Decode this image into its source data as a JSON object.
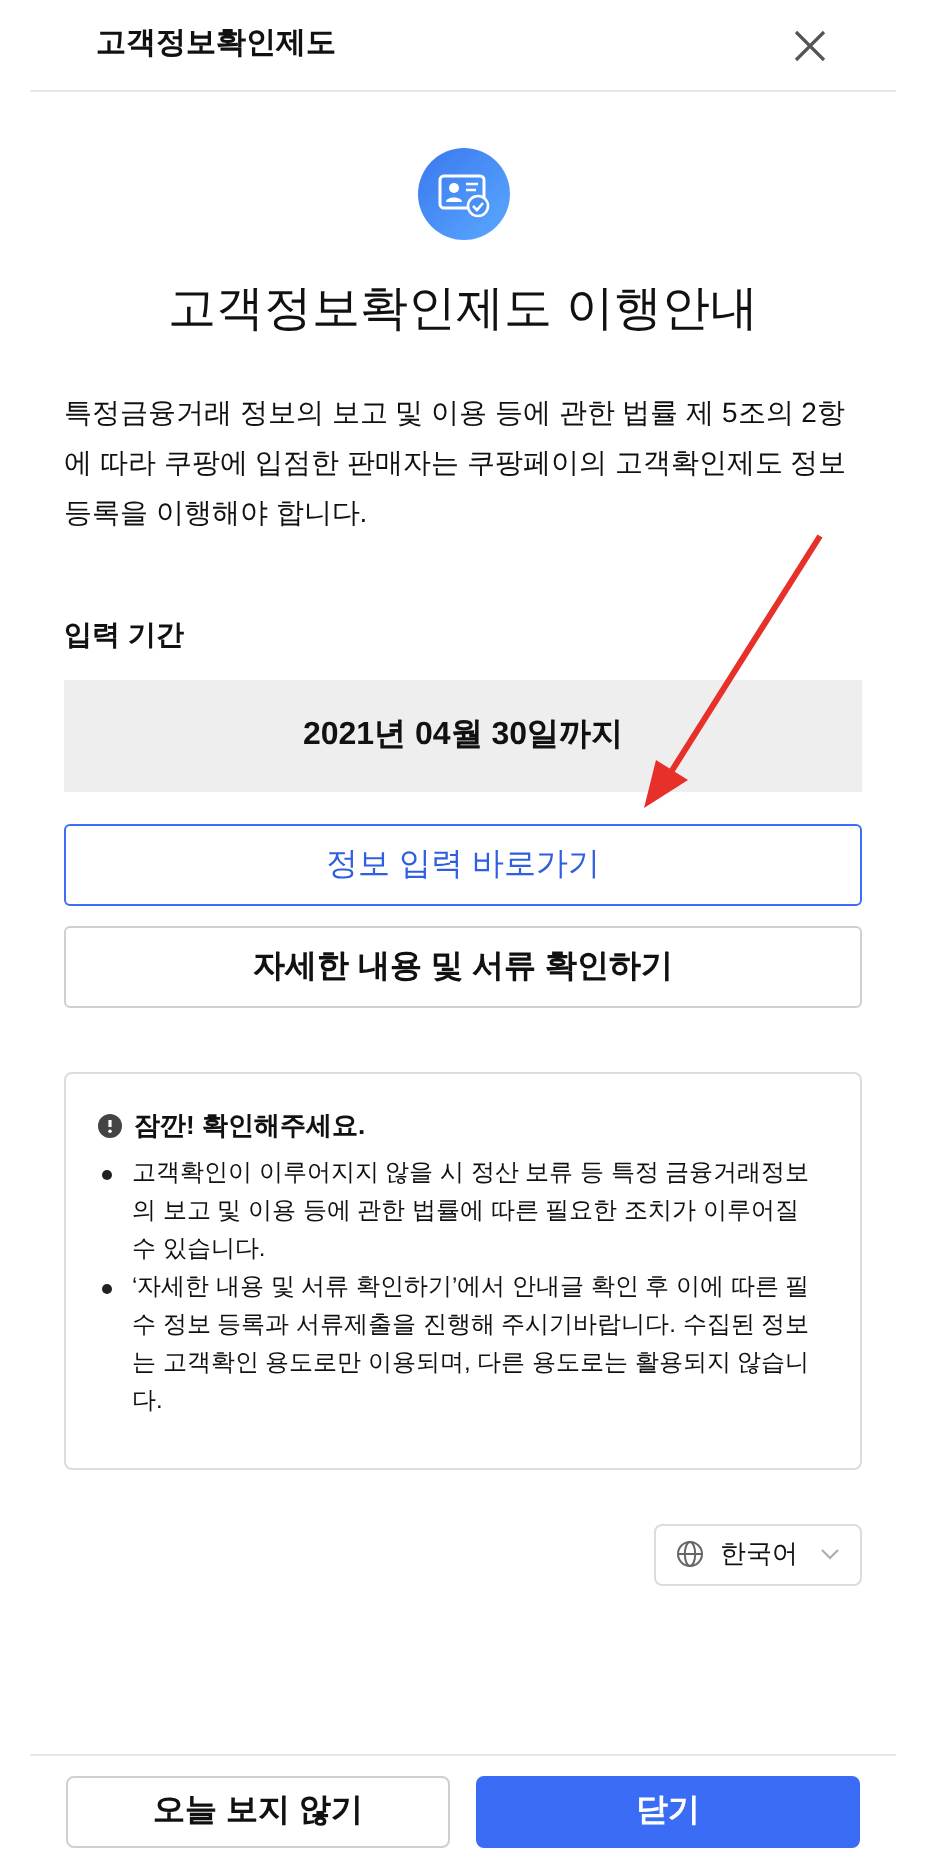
{
  "window": {
    "title": "고객정보확인제도"
  },
  "heading": "고객정보확인제도 이행안내",
  "description": "특정금융거래 정보의 보고 및 이용 등에 관한 법률 제 5조의 2항에 따라 쿠팡에 입점한 판매자는 쿠팡페이의 고객확인제도 정보등록을 이행해야 합니다.",
  "period": {
    "label": "입력 기간",
    "value": "2021년 04월 30일까지"
  },
  "actions": [
    {
      "label": "정보 입력 바로가기",
      "kind": "primary-outline"
    },
    {
      "label": "자세한 내용 및 서류 확인하기",
      "kind": "outline"
    }
  ],
  "notice": {
    "title": "잠깐! 확인해주세요.",
    "items": [
      "고객확인이 이루어지지 않을 시 정산 보류 등 특정 금융거래정보의 보고 및 이용 등에 관한 법률에 따른 필요한 조치가 이루어질 수 있습니다.",
      "‘자세한 내용 및 서류 확인하기’에서 안내글 확인 후 이에 따른 필수 정보 등록과 서류제출을 진행해 주시기바랍니다. 수집된 정보는 고객확인 용도로만 이용되며, 다른 용도로는 활용되지 않습니다."
    ]
  },
  "language": {
    "value": "한국어"
  },
  "footer": [
    {
      "label": "오늘 보지 않기",
      "kind": "outline"
    },
    {
      "label": "닫기",
      "kind": "primary"
    }
  ]
}
